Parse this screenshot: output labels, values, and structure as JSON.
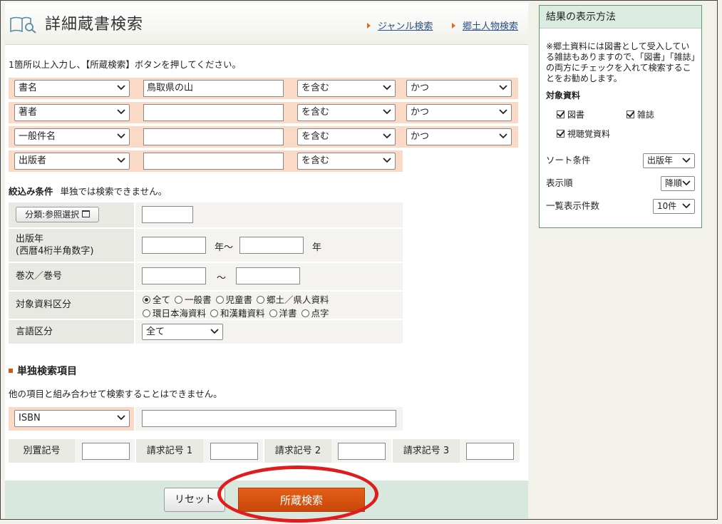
{
  "header": {
    "title": "詳細蔵書検索",
    "links": [
      "ジャンル検索",
      "郷土人物検索"
    ]
  },
  "instruction": "1箇所以上入力し、【所蔵検索】ボタンを押してください。",
  "criteria_rows": [
    {
      "field": "書名",
      "value": "鳥取県の山",
      "match": "を含む",
      "logic": "かつ"
    },
    {
      "field": "著者",
      "value": "",
      "match": "を含む",
      "logic": "かつ"
    },
    {
      "field": "一般件名",
      "value": "",
      "match": "を含む",
      "logic": "かつ"
    },
    {
      "field": "出版者",
      "value": "",
      "match": "を含む"
    }
  ],
  "filter": {
    "label": "絞込み条件",
    "note": "単独では検索できません。",
    "classification_button": "分類:参照選択",
    "pubyear_label_1": "出版年",
    "pubyear_label_2": "(西暦4桁半角数字)",
    "year_sep": "年〜",
    "year_end": "年",
    "volume_label": "巻次／巻号",
    "volume_sep": "〜",
    "material_label": "対象資料区分",
    "material_options": [
      "全て",
      "一般書",
      "児童書",
      "郷土／県人資料",
      "環日本海資料",
      "和漢籍資料",
      "洋書",
      "点字"
    ],
    "material_selected": "全て",
    "language_label": "言語区分",
    "language_value": "全て"
  },
  "standalone": {
    "heading": "単独検索項目",
    "note": "他の項目と組み合わせて検索することはできません。",
    "isbn_field": "ISBN",
    "call_labels": [
      "別置記号",
      "請求記号 1",
      "請求記号 2",
      "請求記号 3"
    ]
  },
  "footer": {
    "reset_label": "リセット",
    "search_label": "所蔵検索"
  },
  "sidebar": {
    "heading": "結果の表示方法",
    "note": "※郷土資料には図書として受入している雑誌もありますので、「図書」「雑誌」の両方にチェックを入れて検索することをお勧めします。",
    "target_label": "対象資料",
    "checks": [
      "図書",
      "雑誌",
      "視聴覚資料"
    ],
    "sort_label": "ソート条件",
    "sort_value": "出版年",
    "order_label": "表示順",
    "order_value": "降順",
    "count_label": "一覧表示件数",
    "count_value": "10件"
  },
  "colors": {
    "accent": "#d85a12",
    "highlight": "#e01c1c",
    "sidebar_border": "#5b9a72"
  }
}
